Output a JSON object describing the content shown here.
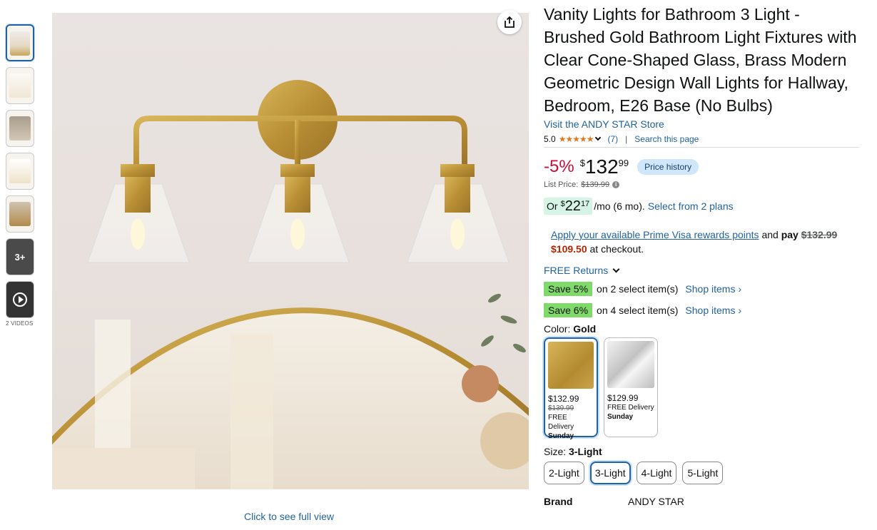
{
  "thumbnails": {
    "more_label": "3+",
    "videos_label": "2 VIDEOS"
  },
  "main_image": {
    "full_view_label": "Click to see full view"
  },
  "product": {
    "title": "Vanity Lights for Bathroom 3 Light - Brushed Gold Bathroom Light Fixtures with Clear Cone-Shaped Glass, Brass Modern Geometric Design Wall Lights for Hallway, Bedroom, E26 Base (No Bulbs)",
    "store_link": "Visit the ANDY STAR Store",
    "rating": "5.0",
    "stars": "★★★★★",
    "rating_count": "(7)",
    "search_page": "Search this page"
  },
  "pricing": {
    "discount": "-5%",
    "currency": "$",
    "whole": "132",
    "fraction": "99",
    "price_history_label": "Price history",
    "list_price_label": "List Price:",
    "list_price": "$139.99",
    "install_prefix": "Or",
    "install_currency": "$",
    "install_whole": "22",
    "install_fraction": "17",
    "install_suffix": "/mo (6 mo).",
    "install_plans": "Select from 2 plans"
  },
  "prime": {
    "link": "Apply your available Prime Visa rewards points",
    "and": "and",
    "pay": "pay",
    "old_price": "$132.99",
    "new_price": "$109.50",
    "suffix": "at checkout."
  },
  "returns": {
    "label": "FREE Returns"
  },
  "savings": [
    {
      "badge": "Save 5%",
      "text": "on 2 select item(s)",
      "link": "Shop items ›"
    },
    {
      "badge": "Save 6%",
      "text": "on 4 select item(s)",
      "link": "Shop items ›"
    }
  ],
  "color": {
    "label": "Color:",
    "value": "Gold",
    "options": [
      {
        "price": "$132.99",
        "old": "$139.99",
        "delivery": "FREE Delivery",
        "day": "Sunday",
        "color": "#c9a44a"
      },
      {
        "price": "$129.99",
        "old": "",
        "delivery": "FREE Delivery",
        "day": "Sunday",
        "color": "#d9d9d9"
      }
    ]
  },
  "size": {
    "label": "Size:",
    "value": "3-Light",
    "options": [
      "2-Light",
      "3-Light",
      "4-Light",
      "5-Light"
    ]
  },
  "brand": {
    "key": "Brand",
    "value": "ANDY STAR"
  }
}
